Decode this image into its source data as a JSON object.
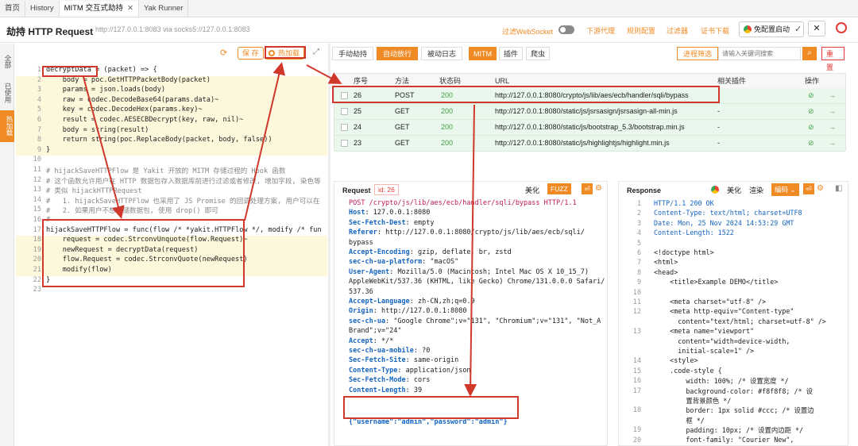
{
  "tabs": [
    {
      "label": "首页"
    },
    {
      "label": "History"
    },
    {
      "label": "MITM 交互式劫持"
    },
    {
      "label": "Yak Runner"
    }
  ],
  "title": "劫持 HTTP Request",
  "proxy_addr": "http://127.0.0.1:8083  via socks5://127.0.0.1:8083",
  "websocket_label": "过滤WebSocket",
  "top_links": [
    "下游代理",
    "规则配置",
    "过滤器",
    "证书下载"
  ],
  "free_proxy_label": "免配置启动",
  "sidebar": [
    "全部",
    "已使用",
    "热加载"
  ],
  "editor": {
    "save": "保 存",
    "hot_reload": "热加载",
    "lines": [
      "decryptData = (packet) => {",
      "    body = poc.GetHTTPPacketBody(packet)",
      "    params = json.loads(body)",
      "    raw = codec.DecodeBase64(params.data)~",
      "    key = codec.DecodeHex(params.key)~",
      "    result = codec.AESECBDecrypt(key, raw, nil)~",
      "    body = string(result)",
      "    return string(poc.ReplaceBody(packet, body, false))",
      "}",
      "",
      "# hijackSaveHTTPFlow 是 Yakit 开放的 MITM 存储过程的 Hook 函数",
      "# 这个函数允许用户在 HTTP 数据包存入数据库前进行过滤或者修改, 增加字段, 染色等",
      "# 类似 hijackHTTPRequest",
      "#   1. hijackSaveHTTPFlow 也采用了 JS Promise 的回调处理方案, 用户可以在",
      "#   2. 如果用户不想存储数据包, 使用 drop() 即可",
      "#",
      "hijackSaveHTTPFlow = func(flow /* *yakit.HTTPFlow */, modify /* fun",
      "    request = codec.StrconvUnquote(flow.Request)~",
      "    newRequest = decryptData(request)",
      "    flow.Request = codec.StrconvQuote(newRequest)",
      "    modify(flow)",
      "}",
      ""
    ]
  },
  "mitm": {
    "modes": [
      "手动劫持",
      "自动放行",
      "被动日志"
    ],
    "mitm_label": "MITM",
    "plugin_label": "插件",
    "crawler_label": "爬虫",
    "filter_btn": "进程筛选",
    "search_placeholder": "请输入关键词搜索",
    "reset_btn": "重 置"
  },
  "table": {
    "headers": [
      "序号",
      "方法",
      "状态码",
      "URL",
      "相关插件",
      "操作"
    ],
    "rows": [
      {
        "id": "26",
        "method": "POST",
        "status": "200",
        "url": "http://127.0.0.1:8080/crypto/js/lib/aes/ecb/handler/sqli/bypass",
        "plugin": ""
      },
      {
        "id": "25",
        "method": "GET",
        "status": "200",
        "url": "http://127.0.0.1:8080/static/js/jsrsasign/jsrsasign-all-min.js",
        "plugin": "-"
      },
      {
        "id": "24",
        "method": "GET",
        "status": "200",
        "url": "http://127.0.0.1:8080/static/js/bootstrap_5.3/bootstrap.min.js",
        "plugin": "-"
      },
      {
        "id": "23",
        "method": "GET",
        "status": "200",
        "url": "http://127.0.0.1:8080/static/js/highlightjs/highlight.min.js",
        "plugin": "-"
      }
    ]
  },
  "request": {
    "title": "Request",
    "id_label": "id: 26",
    "beautify": "美化",
    "fuzz": "FUZZ",
    "lines": [
      [
        "POST /crypto/js/lib/aes/ecb/handler/sqli/bypass HTTP/1.1",
        ""
      ],
      [
        "Host",
        "127.0.0.1:8080"
      ],
      [
        "Sec-Fetch-Dest",
        "empty"
      ],
      [
        "Referer",
        "http://127.0.0.1:8080/crypto/js/lib/aes/ecb/sqli/"
      ],
      [
        "",
        "bypass"
      ],
      [
        "Accept-Encoding",
        "gzip, deflate, br, zstd"
      ],
      [
        "sec-ch-ua-platform",
        "\"macOS\""
      ],
      [
        "User-Agent",
        "Mozilla/5.0 (Macintosh; Intel Mac OS X 10_15_7)"
      ],
      [
        "",
        "AppleWebKit/537.36 (KHTML, like Gecko) Chrome/131.0.0.0 Safari/"
      ],
      [
        "",
        "537.36"
      ],
      [
        "Accept-Language",
        "zh-CN,zh;q=0.9"
      ],
      [
        "Origin",
        "http://127.0.0.1:8080"
      ],
      [
        "sec-ch-ua",
        "\"Google Chrome\";v=\"131\", \"Chromium\";v=\"131\", \"Not_A"
      ],
      [
        "",
        "Brand\";v=\"24\""
      ],
      [
        "Accept",
        "*/*"
      ],
      [
        "sec-ch-ua-mobile",
        "?0"
      ],
      [
        "Sec-Fetch-Site",
        "same-origin"
      ],
      [
        "Content-Type",
        "application/json"
      ],
      [
        "Sec-Fetch-Mode",
        "cors"
      ],
      [
        "Content-Length",
        "39"
      ],
      [
        "",
        ""
      ],
      [
        "{\"username\":\"admin\",\"password\":\"admin\"}",
        ""
      ]
    ]
  },
  "response": {
    "title": "Response",
    "beautify": "美化",
    "render": "渲染",
    "encode": "编码",
    "lines": [
      [
        "1",
        "HTTP/1.1 200 OK"
      ],
      [
        "2",
        "Content-Type: text/html; charset=UTF8"
      ],
      [
        "3",
        "Date: Mon, 25 Nov 2024 14:53:29 GMT"
      ],
      [
        "4",
        "Content-Length: 1522"
      ],
      [
        "5",
        ""
      ],
      [
        "6",
        "<!doctype html>"
      ],
      [
        "7",
        "<html>"
      ],
      [
        "8",
        "<head>"
      ],
      [
        "9",
        "    <title>Example DEMO</title>"
      ],
      [
        "10",
        ""
      ],
      [
        "11",
        "    <meta charset=\"utf-8\" />"
      ],
      [
        "12",
        "    <meta http-equiv=\"Content-type\""
      ],
      [
        "",
        "      content=\"text/html; charset=utf-8\" />"
      ],
      [
        "13",
        "    <meta name=\"viewport\""
      ],
      [
        "",
        "      content=\"width=device-width,"
      ],
      [
        "",
        "      initial-scale=1\" />"
      ],
      [
        "14",
        "    <style>"
      ],
      [
        "15",
        "    .code-style {"
      ],
      [
        "16",
        "        width: 100%; /* 设置宽度 */"
      ],
      [
        "17",
        "        background-color: #f8f8f8; /* 设"
      ],
      [
        "",
        "        置背景颜色 */"
      ],
      [
        "18",
        "        border: 1px solid #ccc; /* 设置边"
      ],
      [
        "",
        "        框 */"
      ],
      [
        "19",
        "        padding: 10px; /* 设置内边距 */"
      ],
      [
        "20",
        "        font-family: \"Courier New\","
      ]
    ]
  }
}
